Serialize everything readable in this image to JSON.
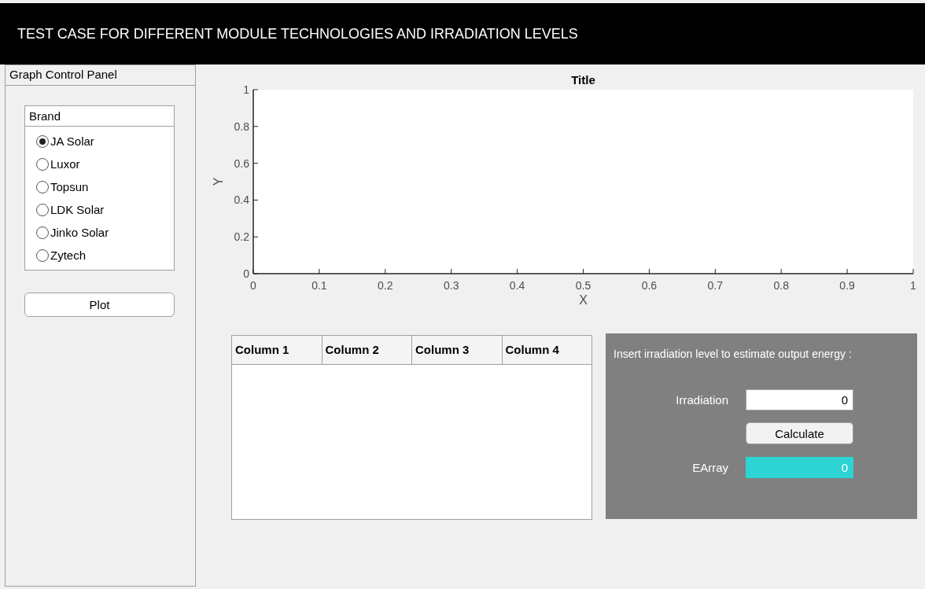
{
  "header": {
    "title": "TEST CASE FOR DIFFERENT MODULE TECHNOLOGIES AND IRRADIATION LEVELS"
  },
  "control_panel": {
    "title": "Graph Control Panel",
    "brand": {
      "title": "Brand",
      "options": [
        {
          "label": "JA Solar",
          "selected": true
        },
        {
          "label": "Luxor",
          "selected": false
        },
        {
          "label": "Topsun",
          "selected": false
        },
        {
          "label": "LDK Solar",
          "selected": false
        },
        {
          "label": "Jinko Solar",
          "selected": false
        },
        {
          "label": "Zytech",
          "selected": false
        }
      ]
    },
    "plot_button": "Plot"
  },
  "plot": {
    "chart_data": {
      "type": "line",
      "title": "Title",
      "xlabel": "X",
      "ylabel": "Y",
      "xlim": [
        0,
        1
      ],
      "ylim": [
        0,
        1
      ],
      "xticks": [
        0,
        0.1,
        0.2,
        0.3,
        0.4,
        0.5,
        0.6,
        0.7,
        0.8,
        0.9,
        1
      ],
      "yticks": [
        0,
        0.2,
        0.4,
        0.6,
        0.8,
        1
      ]
    }
  },
  "table": {
    "columns": [
      "Column 1",
      "Column 2",
      "Column 3",
      "Column 4"
    ]
  },
  "calculator": {
    "prompt": "Insert irradiation level to estimate output energy :",
    "irradiation": {
      "label": "Irradiation",
      "value": "0"
    },
    "calculate_button": "Calculate",
    "earray": {
      "label": "EArray",
      "value": "0"
    }
  }
}
